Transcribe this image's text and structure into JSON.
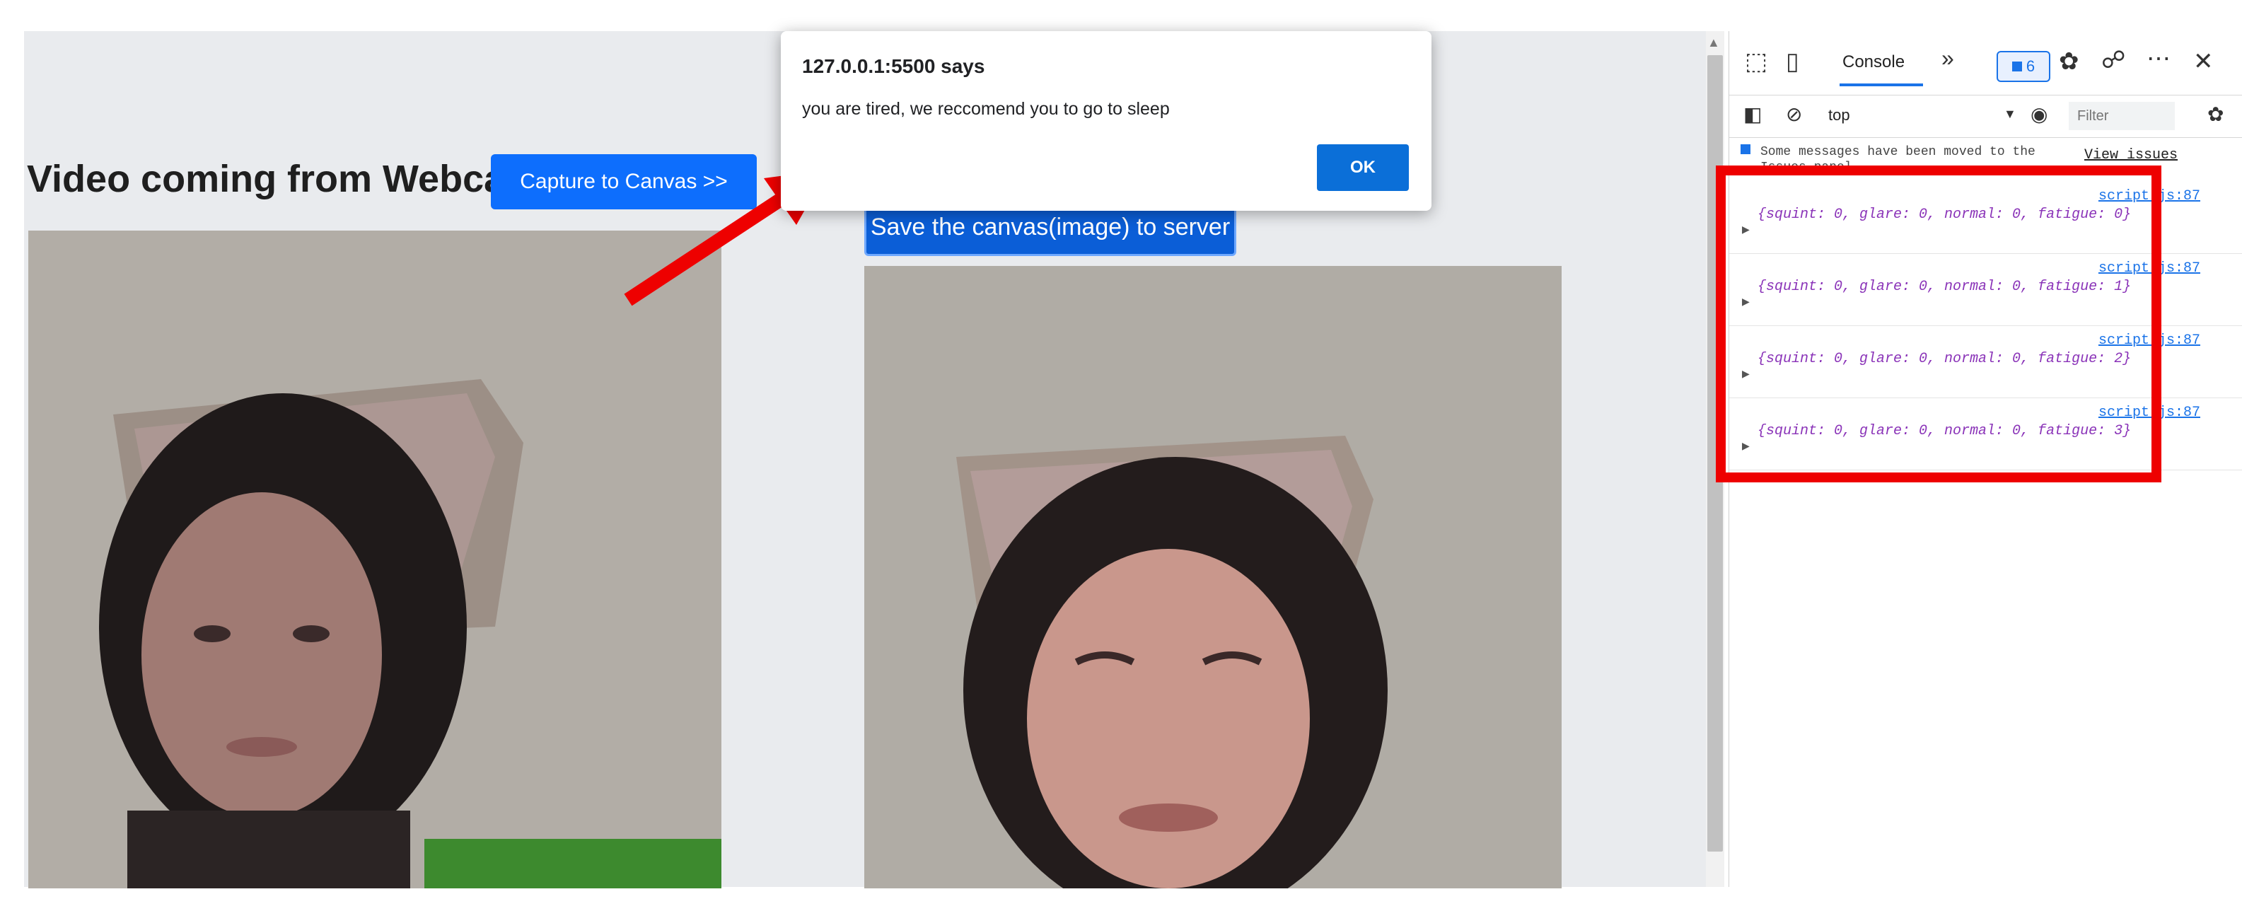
{
  "page": {
    "heading": "Video coming from Webcam",
    "capture_button": "Capture to Canvas >>",
    "save_button": "Save the canvas(image) to server"
  },
  "dialog": {
    "title": "127.0.0.1:5500 says",
    "message": "you are tired, we reccomend you to go to sleep",
    "ok_label": "OK"
  },
  "devtools": {
    "tab_console": "Console",
    "more_tabs": "»",
    "issues_count": "6",
    "context": "top",
    "filter_placeholder": "Filter",
    "info_message": "Some messages have been moved to the Issues panel.",
    "view_issues": "View issues",
    "logs": [
      {
        "source": "script.js:87",
        "text": "{squint: 0, glare: 0, normal: 0, fatigue: 0}"
      },
      {
        "source": "script.js:87",
        "text": "{squint: 0, glare: 0, normal: 0, fatigue: 1}"
      },
      {
        "source": "script.js:87",
        "text": "{squint: 0, glare: 0, normal: 0, fatigue: 2}"
      },
      {
        "source": "script.js:87",
        "text": "{squint: 0, glare: 0, normal: 0, fatigue: 3}"
      }
    ],
    "prompt": "›"
  },
  "colors": {
    "primary_button": "#0d6efd",
    "highlight_box": "#ee0000",
    "arrow": "#ee0000",
    "log_text": "#8a33b8",
    "link": "#1a73e8"
  },
  "icons": [
    "inspect-element-icon",
    "device-toggle-icon",
    "issues-flag-icon",
    "settings-gear-icon",
    "connection-icon",
    "more-options-icon",
    "close-icon",
    "sidebar-toggle-icon",
    "clear-console-icon",
    "eye-icon",
    "console-settings-icon"
  ]
}
